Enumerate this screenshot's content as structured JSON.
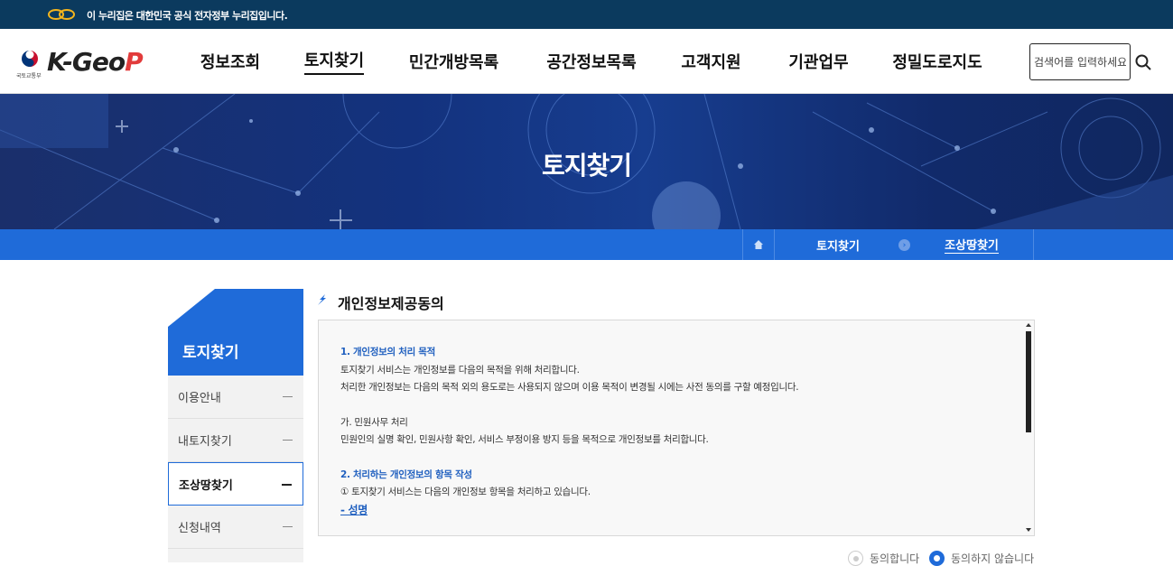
{
  "gov_banner": {
    "text": "이 누리집은 대한민국 공식 전자정부 누리집입니다."
  },
  "header": {
    "logo_sub": "국토교통부",
    "logo_main": "K-Geo",
    "logo_accent": "P",
    "nav": [
      {
        "label": "정보조회",
        "active": false
      },
      {
        "label": "토지찾기",
        "active": true
      },
      {
        "label": "민간개방목록",
        "active": false
      },
      {
        "label": "공간정보목록",
        "active": false
      },
      {
        "label": "고객지원",
        "active": false
      },
      {
        "label": "기관업무",
        "active": false
      },
      {
        "label": "정밀도로지도",
        "active": false
      }
    ],
    "search_placeholder": "검색어를 입력하세요."
  },
  "hero": {
    "title": "토지찾기"
  },
  "breadcrumb": {
    "level1": "토지찾기",
    "level2": "조상땅찾기"
  },
  "sidebar": {
    "title": "토지찾기",
    "items": [
      {
        "label": "이용안내",
        "active": false
      },
      {
        "label": "내토지찾기",
        "active": false
      },
      {
        "label": "조상땅찾기",
        "active": true
      },
      {
        "label": "신청내역",
        "active": false
      }
    ]
  },
  "content": {
    "section_title": "개인정보제공동의",
    "terms": {
      "h1": "1. 개인정보의 처리 목적",
      "p1": "토지찾기 서비스는 개인정보를 다음의 목적을 위해 처리합니다.",
      "p2": "처리한 개인정보는 다음의 목적 외의 용도로는 사용되지 않으며 이용 목적이 변경될 시에는 사전 동의를 구할 예정입니다.",
      "sub1": "가. 민원사무 처리",
      "p3": "민원인의 실명 확인, 민원사항 확인, 서비스 부정이용 방지 등을 목적으로 개인정보를 처리합니다.",
      "h2": "2. 처리하는 개인정보의 항목 작성",
      "p4": "① 토지찾기 서비스는 다음의 개인정보 항목을 처리하고 있습니다.",
      "link1": "- 성명"
    },
    "consent": {
      "agree": "동의합니다",
      "disagree": "동의하지 않습니다",
      "selected": "disagree"
    }
  },
  "colors": {
    "brand_blue": "#1f6bd9",
    "gov_bar": "#0b3a5e"
  }
}
